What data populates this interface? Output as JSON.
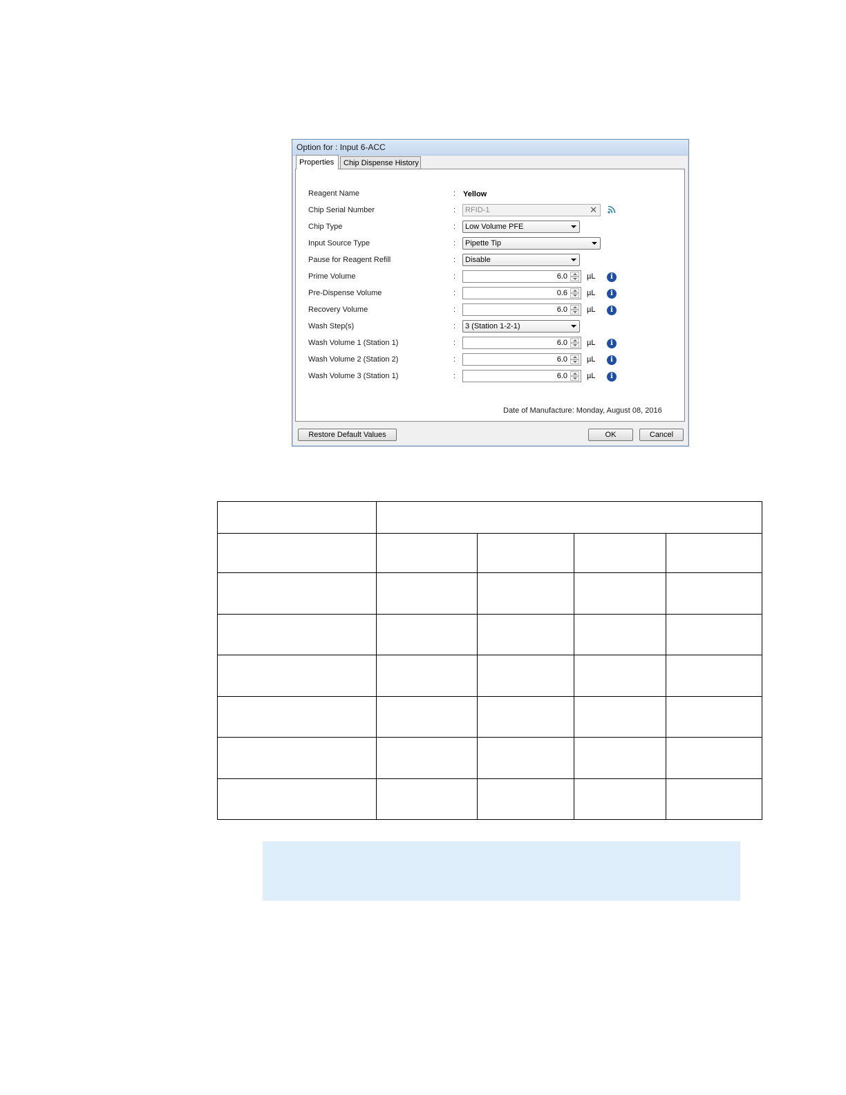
{
  "dialog": {
    "title": "Option for : Input 6-ACC",
    "tabs": [
      {
        "label": "Properties",
        "active": true
      },
      {
        "label": "Chip Dispense History",
        "active": false
      }
    ],
    "fields": {
      "reagent_name": {
        "label": "Reagent Name",
        "value": "Yellow"
      },
      "chip_serial_number": {
        "label": "Chip Serial Number",
        "value": "RFID-1"
      },
      "chip_type": {
        "label": "Chip Type",
        "value": "Low Volume PFE"
      },
      "input_source_type": {
        "label": "Input Source Type",
        "value": "Pipette Tip"
      },
      "pause_for_reagent_refill": {
        "label": "Pause for Reagent Refill",
        "value": "Disable"
      },
      "prime_volume": {
        "label": "Prime Volume",
        "value": "6.0",
        "unit": "µL"
      },
      "pre_dispense_volume": {
        "label": "Pre-Dispense Volume",
        "value": "0.6",
        "unit": "µL"
      },
      "recovery_volume": {
        "label": "Recovery Volume",
        "value": "6.0",
        "unit": "µL"
      },
      "wash_steps": {
        "label": "Wash Step(s)",
        "value": "3 (Station 1-2-1)"
      },
      "wash_volume_1": {
        "label": "Wash Volume 1 (Station 1)",
        "value": "6.0",
        "unit": "µL"
      },
      "wash_volume_2": {
        "label": "Wash Volume 2 (Station 2)",
        "value": "6.0",
        "unit": "µL"
      },
      "wash_volume_3": {
        "label": "Wash Volume 3 (Station 1)",
        "value": "6.0",
        "unit": "µL"
      }
    },
    "colon": ":",
    "date_of_manufacture": "Date of Manufacture: Monday, August 08, 2016",
    "buttons": {
      "restore": "Restore Default Values",
      "ok": "OK",
      "cancel": "Cancel"
    },
    "icons": {
      "info": "info-icon",
      "clear": "close-icon",
      "rfid": "rss-signal-icon"
    },
    "colors": {
      "info_blue": "#1f4fa3",
      "rss_teal": "#2a7fa8",
      "note_bg": "#deeefb"
    }
  }
}
